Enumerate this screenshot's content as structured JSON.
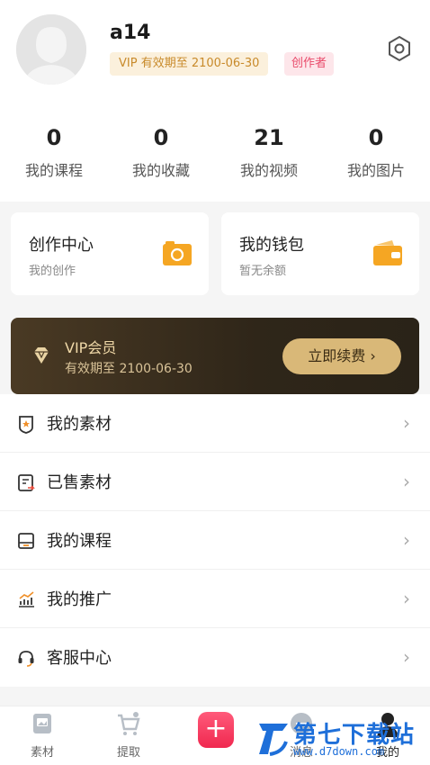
{
  "profile": {
    "username": "a14",
    "vip_badge": "VIP 有效期至 2100-06-30",
    "creator_badge": "创作者"
  },
  "stats": [
    {
      "value": "0",
      "label": "我的课程"
    },
    {
      "value": "0",
      "label": "我的收藏"
    },
    {
      "value": "21",
      "label": "我的视频"
    },
    {
      "value": "0",
      "label": "我的图片"
    }
  ],
  "cards": {
    "creation": {
      "title": "创作中心",
      "subtitle": "我的创作"
    },
    "wallet": {
      "title": "我的钱包",
      "subtitle": "暂无余额"
    }
  },
  "vip": {
    "title": "VIP会员",
    "expiry": "有效期至 2100-06-30",
    "button": "立即续费 ›"
  },
  "menu": [
    {
      "label": "我的素材",
      "icon": "material-icon"
    },
    {
      "label": "已售素材",
      "icon": "sold-icon"
    },
    {
      "label": "我的课程",
      "icon": "course-icon"
    },
    {
      "label": "我的推广",
      "icon": "promotion-icon"
    },
    {
      "label": "客服中心",
      "icon": "headset-icon"
    }
  ],
  "bottom_nav": {
    "items": [
      {
        "label": "素材",
        "icon": "gallery-icon"
      },
      {
        "label": "提取",
        "icon": "cart-icon"
      },
      {
        "label": "消息",
        "icon": "message-icon"
      },
      {
        "label": "我的",
        "icon": "person-icon"
      }
    ],
    "publish_icon": "plus-icon"
  },
  "watermark": {
    "text": "第七下载站",
    "url": "www.d7down.com"
  },
  "colors": {
    "accent": "#f0284f",
    "vip_gold": "#d9b878",
    "card_icon": "#f5a623"
  }
}
